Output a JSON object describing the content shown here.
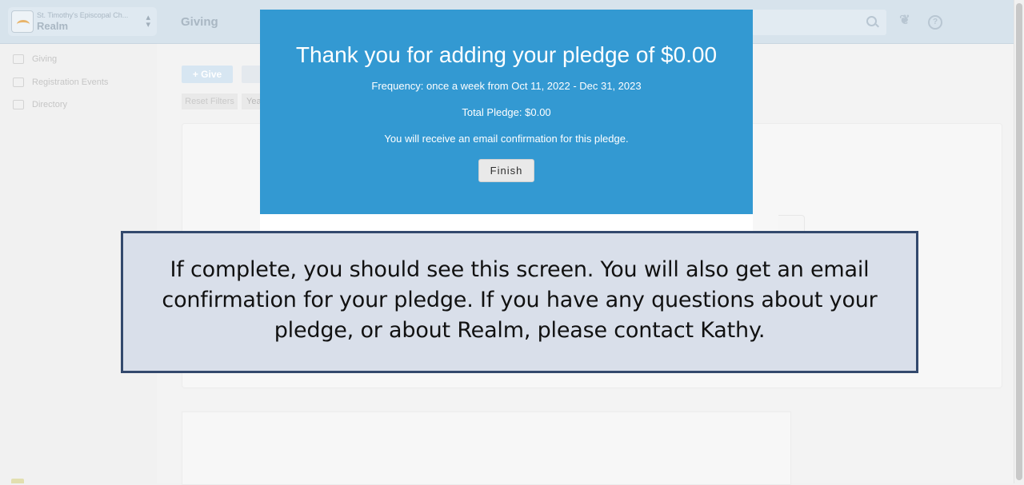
{
  "topbar": {
    "org_name": "St. Timothy's Episcopal Ch...",
    "app_name": "Realm",
    "page_title": "Giving",
    "icons": [
      "search-icon",
      "leaf-icon",
      "help-icon"
    ]
  },
  "sidebar": {
    "items": [
      {
        "label": "Giving",
        "icon": "giving-icon"
      },
      {
        "label": "Registration Events",
        "icon": "calendar-icon"
      },
      {
        "label": "Directory",
        "icon": "directory-icon"
      }
    ]
  },
  "main": {
    "give_label": "+ Give",
    "reset_filters_label": "Reset Filters",
    "year_chip_label": "Yea"
  },
  "modal": {
    "title": "Thank you for adding your pledge of $0.00",
    "frequency": "Frequency: once a week from Oct 11, 2022 - Dec 31, 2023",
    "total": "Total Pledge: $0.00",
    "email_note": "You will receive an email confirmation for this pledge.",
    "finish_label": "Finish",
    "header_color": "#3399d2"
  },
  "callout": {
    "text": "If complete, you should see this screen. You will also get an email confirmation for your pledge. If you have any questions about your pledge, or about Realm, please contact Kathy.",
    "background": "#d9dfea",
    "border": "#33496d"
  }
}
